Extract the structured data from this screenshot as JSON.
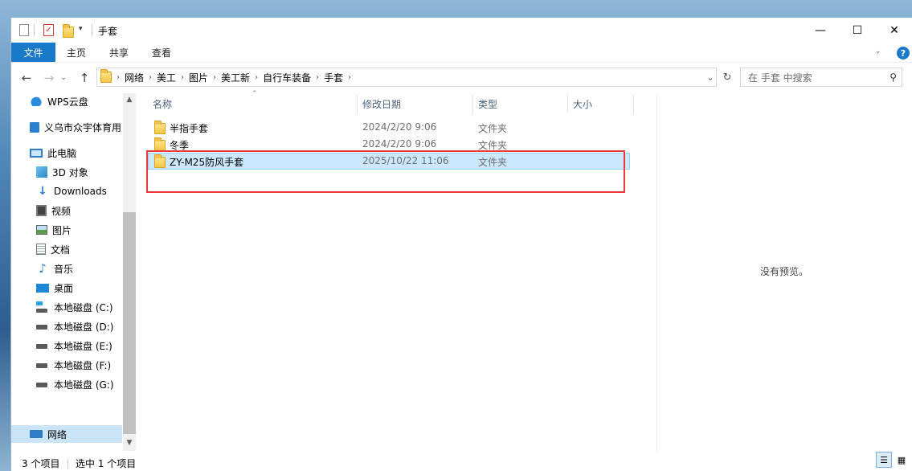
{
  "window": {
    "title": "手套",
    "controls": {
      "minimize": "—",
      "maximize": "☐",
      "close": "✕"
    }
  },
  "ribbon": {
    "tabs": [
      "文件",
      "主页",
      "共享",
      "查看"
    ],
    "help_icon": "?"
  },
  "address_bar": {
    "breadcrumbs": [
      "网络",
      "美工",
      "图片",
      "美工新",
      "自行车装备",
      "手套"
    ],
    "search_placeholder": "在 手套 中搜索"
  },
  "sidebar": {
    "items": [
      {
        "label": "WPS云盘",
        "icon": "cloud-icon"
      },
      {
        "label": "义乌市众宇体育用",
        "icon": "building-icon"
      },
      {
        "label": "此电脑",
        "icon": "computer-icon"
      },
      {
        "label": "3D 对象",
        "icon": "cube-icon"
      },
      {
        "label": "Downloads",
        "icon": "download-icon"
      },
      {
        "label": "视频",
        "icon": "video-icon"
      },
      {
        "label": "图片",
        "icon": "picture-icon"
      },
      {
        "label": "文档",
        "icon": "document-icon"
      },
      {
        "label": "音乐",
        "icon": "music-icon"
      },
      {
        "label": "桌面",
        "icon": "desktop-icon"
      },
      {
        "label": "本地磁盘 (C:)",
        "icon": "drive-icon"
      },
      {
        "label": "本地磁盘 (D:)",
        "icon": "drive-icon"
      },
      {
        "label": "本地磁盘 (E:)",
        "icon": "drive-icon"
      },
      {
        "label": "本地磁盘 (F:)",
        "icon": "drive-icon"
      },
      {
        "label": "本地磁盘 (G:)",
        "icon": "drive-icon"
      },
      {
        "label": "网络",
        "icon": "network-icon"
      }
    ],
    "selected": "网络"
  },
  "file_list": {
    "columns": [
      "名称",
      "修改日期",
      "类型",
      "大小"
    ],
    "rows": [
      {
        "name": "半指手套",
        "date": "2024/2/20 9:06",
        "type": "文件夹",
        "size": ""
      },
      {
        "name": "冬季",
        "date": "2024/2/20 9:06",
        "type": "文件夹",
        "size": ""
      },
      {
        "name": "ZY-M25防风手套",
        "date": "2025/10/22 11:06",
        "type": "文件夹",
        "size": ""
      }
    ],
    "selected_row": 2
  },
  "preview": {
    "text": "没有预览。"
  },
  "status_bar": {
    "item_count": "3 个项目",
    "selection": "选中 1 个项目"
  },
  "colors": {
    "accent": "#1979ca",
    "selection_bg": "#cce8ff",
    "highlight_box": "#e83a3a"
  }
}
